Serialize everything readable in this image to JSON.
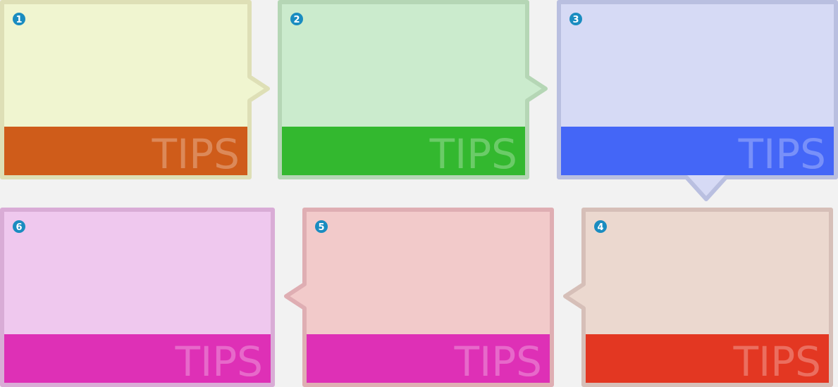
{
  "cards": [
    {
      "number": "1",
      "label": "TIPS",
      "bg": "#f0f5d0",
      "border": "#dedfb6",
      "band": "#cf5c1a",
      "pointer": "right"
    },
    {
      "number": "2",
      "label": "TIPS",
      "bg": "#cbebcd",
      "border": "#b5d6b5",
      "band": "#33b82f",
      "pointer": "right"
    },
    {
      "number": "3",
      "label": "TIPS",
      "bg": "#d6daf5",
      "border": "#b9bfe0",
      "band": "#4466f7",
      "pointer": "bottom"
    },
    {
      "number": "4",
      "label": "TIPS",
      "bg": "#ebd8cf",
      "border": "#d6bfb8",
      "band": "#e33722",
      "pointer": "left"
    },
    {
      "number": "5",
      "label": "TIPS",
      "bg": "#f2caca",
      "border": "#dfaeb3",
      "band": "#de30b6",
      "pointer": "left"
    },
    {
      "number": "6",
      "label": "TIPS",
      "bg": "#efc8ee",
      "border": "#d9acd6",
      "band": "#de30b6",
      "pointer": "none"
    }
  ],
  "colors": {
    "number_badge": "#1a8cc0",
    "background": "#f2f2f2"
  }
}
